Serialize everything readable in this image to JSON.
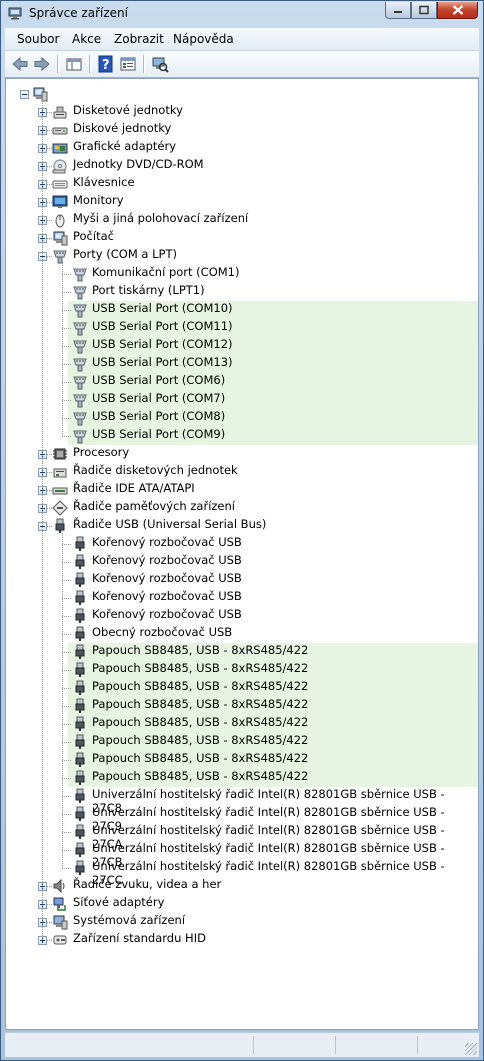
{
  "window": {
    "title": "Správce zařízení"
  },
  "menu": [
    {
      "key": "soubor",
      "label": "Soubor"
    },
    {
      "key": "akce",
      "label": "Akce"
    },
    {
      "key": "zobrazit",
      "label": "Zobrazit"
    },
    {
      "key": "napoveda",
      "label": "Nápověda"
    }
  ],
  "toolbar": [
    {
      "key": "back",
      "icon": "back-arrow-icon"
    },
    {
      "key": "forward",
      "icon": "forward-arrow-icon"
    },
    {
      "key": "up",
      "icon": "show-hide-tree-icon"
    },
    {
      "key": "help",
      "icon": "help-icon"
    },
    {
      "key": "properties",
      "icon": "properties-icon"
    },
    {
      "key": "scan",
      "icon": "scan-hardware-icon"
    }
  ],
  "tree": {
    "root_icon": "computer-icon",
    "categories": [
      {
        "label": "Disketové jednotky",
        "icon": "floppy-icon",
        "expanded": false
      },
      {
        "label": "Diskové jednotky",
        "icon": "disk-icon",
        "expanded": false
      },
      {
        "label": "Grafické adaptéry",
        "icon": "display-adapter-icon",
        "expanded": false
      },
      {
        "label": "Jednotky DVD/CD-ROM",
        "icon": "dvd-icon",
        "expanded": false
      },
      {
        "label": "Klávesnice",
        "icon": "keyboard-icon",
        "expanded": false
      },
      {
        "label": "Monitory",
        "icon": "monitor-icon",
        "expanded": false
      },
      {
        "label": "Myši a jiná polohovací zařízení",
        "icon": "mouse-icon",
        "expanded": false
      },
      {
        "label": "Počítač",
        "icon": "computer-icon",
        "expanded": false
      },
      {
        "label": "Porty (COM a LPT)",
        "icon": "port-icon",
        "expanded": true,
        "children": [
          {
            "label": "Komunikační port (COM1)",
            "icon": "port-icon",
            "highlight": false
          },
          {
            "label": "Port tiskárny (LPT1)",
            "icon": "port-icon",
            "highlight": false
          },
          {
            "label": "USB Serial Port (COM10)",
            "icon": "port-icon",
            "highlight": true
          },
          {
            "label": "USB Serial Port (COM11)",
            "icon": "port-icon",
            "highlight": true
          },
          {
            "label": "USB Serial Port (COM12)",
            "icon": "port-icon",
            "highlight": true
          },
          {
            "label": "USB Serial Port (COM13)",
            "icon": "port-icon",
            "highlight": true
          },
          {
            "label": "USB Serial Port (COM6)",
            "icon": "port-icon",
            "highlight": true
          },
          {
            "label": "USB Serial Port (COM7)",
            "icon": "port-icon",
            "highlight": true
          },
          {
            "label": "USB Serial Port (COM8)",
            "icon": "port-icon",
            "highlight": true
          },
          {
            "label": "USB Serial Port (COM9)",
            "icon": "port-icon",
            "highlight": true
          }
        ]
      },
      {
        "label": "Procesory",
        "icon": "processor-icon",
        "expanded": false
      },
      {
        "label": "Řadiče disketových jednotek",
        "icon": "floppy-controller-icon",
        "expanded": false
      },
      {
        "label": "Řadiče IDE ATA/ATAPI",
        "icon": "ide-controller-icon",
        "expanded": false
      },
      {
        "label": "Řadiče paměťových zařízení",
        "icon": "storage-controller-icon",
        "expanded": false
      },
      {
        "label": "Řadiče USB (Universal Serial Bus)",
        "icon": "usb-icon",
        "expanded": true,
        "children": [
          {
            "label": "Kořenový rozbočovač USB",
            "icon": "usb-icon",
            "highlight": false
          },
          {
            "label": "Kořenový rozbočovač USB",
            "icon": "usb-icon",
            "highlight": false
          },
          {
            "label": "Kořenový rozbočovač USB",
            "icon": "usb-icon",
            "highlight": false
          },
          {
            "label": "Kořenový rozbočovač USB",
            "icon": "usb-icon",
            "highlight": false
          },
          {
            "label": "Kořenový rozbočovač USB",
            "icon": "usb-icon",
            "highlight": false
          },
          {
            "label": "Obecný rozbočovač USB",
            "icon": "usb-icon",
            "highlight": false
          },
          {
            "label": "Papouch SB8485, USB - 8xRS485/422",
            "icon": "usb-icon",
            "highlight": true
          },
          {
            "label": "Papouch SB8485, USB - 8xRS485/422",
            "icon": "usb-icon",
            "highlight": true
          },
          {
            "label": "Papouch SB8485, USB - 8xRS485/422",
            "icon": "usb-icon",
            "highlight": true
          },
          {
            "label": "Papouch SB8485, USB - 8xRS485/422",
            "icon": "usb-icon",
            "highlight": true
          },
          {
            "label": "Papouch SB8485, USB - 8xRS485/422",
            "icon": "usb-icon",
            "highlight": true
          },
          {
            "label": "Papouch SB8485, USB - 8xRS485/422",
            "icon": "usb-icon",
            "highlight": true
          },
          {
            "label": "Papouch SB8485, USB - 8xRS485/422",
            "icon": "usb-icon",
            "highlight": true
          },
          {
            "label": "Papouch SB8485, USB - 8xRS485/422",
            "icon": "usb-icon",
            "highlight": true
          },
          {
            "label": "Univerzální hostitelský řadič Intel(R) 82801GB sběrnice USB - 27C8",
            "icon": "usb-icon",
            "highlight": false
          },
          {
            "label": "Univerzální hostitelský řadič Intel(R) 82801GB sběrnice USB - 27C9",
            "icon": "usb-icon",
            "highlight": false
          },
          {
            "label": "Univerzální hostitelský řadič Intel(R) 82801GB sběrnice USB - 27CA",
            "icon": "usb-icon",
            "highlight": false
          },
          {
            "label": "Univerzální hostitelský řadič Intel(R) 82801GB sběrnice USB - 27CB",
            "icon": "usb-icon",
            "highlight": false
          },
          {
            "label": "Univerzální hostitelský řadič Intel(R) 82801GB sběrnice USB - 27CC",
            "icon": "usb-icon",
            "highlight": false
          }
        ]
      },
      {
        "label": "Řadiče zvuku, videa a her",
        "icon": "sound-icon",
        "expanded": false
      },
      {
        "label": "Síťové adaptéry",
        "icon": "network-adapter-icon",
        "expanded": false
      },
      {
        "label": "Systémová zařízení",
        "icon": "system-device-icon",
        "expanded": false
      },
      {
        "label": "Zařízení standardu HID",
        "icon": "hid-icon",
        "expanded": false
      }
    ]
  },
  "colors": {
    "highlight": "#e8f4e2",
    "titlebar": "#bcd1e6",
    "close_button": "#c1422c"
  }
}
